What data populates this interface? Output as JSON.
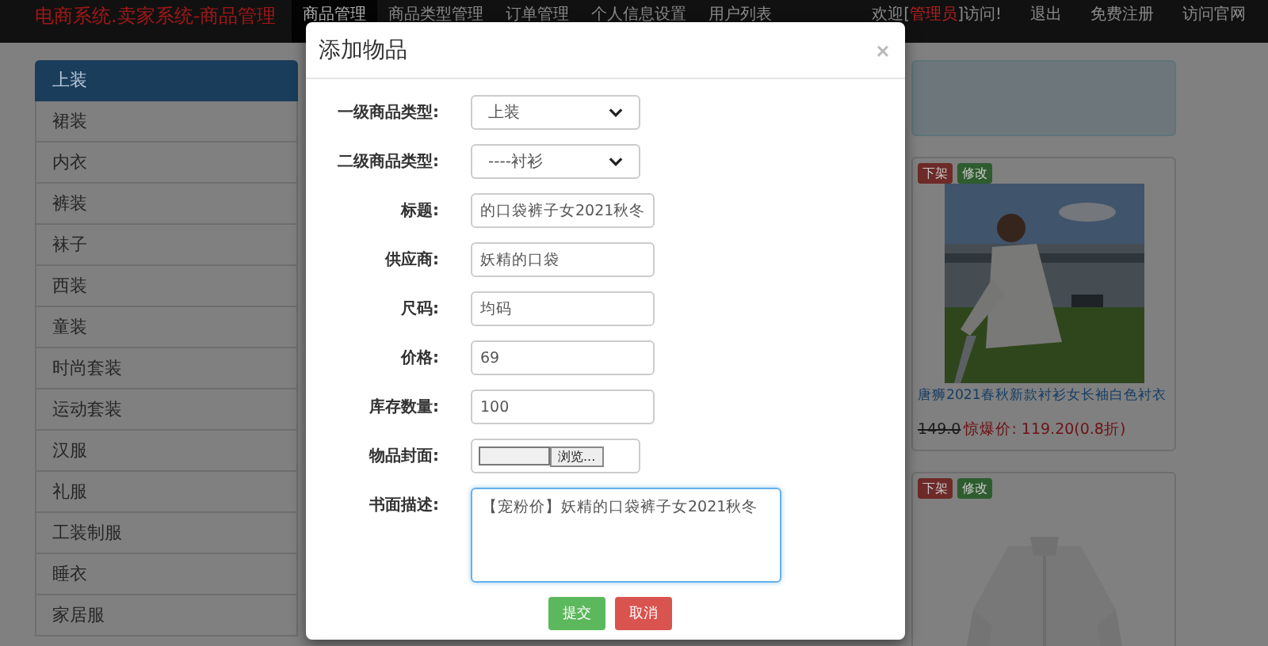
{
  "navbar": {
    "brand": "电商系统.卖家系统-商品管理",
    "menu": [
      {
        "label": "商品管理",
        "selected": true
      },
      {
        "label": "商品类型管理",
        "selected": false
      },
      {
        "label": "订单管理",
        "selected": false
      },
      {
        "label": "个人信息设置",
        "selected": false
      },
      {
        "label": "用户列表",
        "selected": false
      }
    ],
    "welcome": {
      "prefix": "欢迎[",
      "role": "管理员",
      "suffix": "]访问!"
    },
    "links": [
      "退出",
      "免费注册",
      "访问官网"
    ]
  },
  "sidebar": {
    "items": [
      {
        "label": "上装",
        "selected": true
      },
      {
        "label": "裙装",
        "selected": false
      },
      {
        "label": "内衣",
        "selected": false
      },
      {
        "label": "裤装",
        "selected": false
      },
      {
        "label": "袜子",
        "selected": false
      },
      {
        "label": "西装",
        "selected": false
      },
      {
        "label": "童装",
        "selected": false
      },
      {
        "label": "时尚套装",
        "selected": false
      },
      {
        "label": "运动套装",
        "selected": false
      },
      {
        "label": "汉服",
        "selected": false
      },
      {
        "label": "礼服",
        "selected": false
      },
      {
        "label": "工装制服",
        "selected": false
      },
      {
        "label": "睡衣",
        "selected": false
      },
      {
        "label": "家居服",
        "selected": false
      }
    ]
  },
  "products": [
    {
      "badges": [
        {
          "label": "下架",
          "color": "#6d2a28"
        },
        {
          "label": "修改",
          "color": "#2e5c2e"
        }
      ],
      "picture": {
        "kind": "picture"
      },
      "title": "唐狮2021春秋新款衬衫女长袖白色衬衣",
      "original_price": "149.0",
      "deal_price": "惊爆价: 119.20(0.8折)"
    },
    {
      "badges": [
        {
          "label": "下架",
          "color": "#6d2a28"
        },
        {
          "label": "修改",
          "color": "#2e5c2e"
        }
      ],
      "picture": {
        "kind": "picture"
      }
    }
  ],
  "modal": {
    "title": "添加物品",
    "close": "×",
    "fields": [
      {
        "kind": "select",
        "label": "一级商品类型:",
        "value": "上装"
      },
      {
        "kind": "select",
        "label": "二级商品类型:",
        "value": "----衬衫"
      },
      {
        "kind": "input",
        "label": "标题:",
        "value": "的口袋裤子女2021秋冬"
      },
      {
        "kind": "input",
        "label": "供应商:",
        "value": "妖精的口袋"
      },
      {
        "kind": "input",
        "label": "尺码:",
        "value": "均码"
      },
      {
        "kind": "input",
        "label": "价格:",
        "value": "69"
      },
      {
        "kind": "input",
        "label": "库存数量:",
        "value": "100"
      },
      {
        "kind": "file",
        "label": "物品封面:",
        "button": "浏览..."
      },
      {
        "kind": "textarea",
        "label": "书面描述:",
        "value": "【宠粉价】妖精的口袋裤子女2021秋冬"
      }
    ],
    "buttons": [
      {
        "label": "提交",
        "color": "#5cb85c"
      },
      {
        "label": "取消",
        "color": "#d9534f"
      }
    ]
  }
}
